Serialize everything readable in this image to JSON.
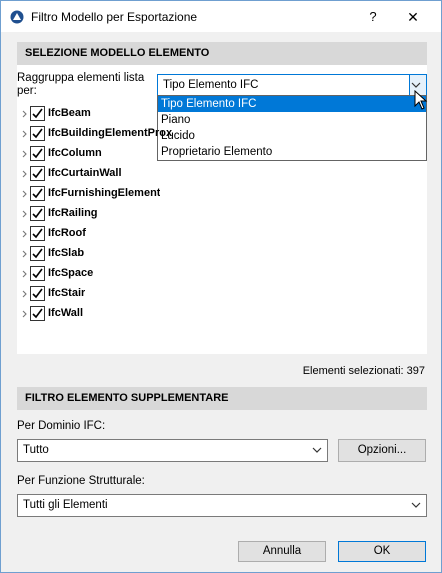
{
  "window": {
    "title": "Filtro Modello per Esportazione",
    "help_label": "?",
    "close_label": "✕"
  },
  "section1": {
    "header": "SELEZIONE MODELLO ELEMENTO"
  },
  "group_by": {
    "label": "Raggruppa elementi lista per:",
    "selected": "Tipo Elemento IFC",
    "options": [
      "Tipo Elemento IFC",
      "Piano",
      "Lucido",
      "Proprietario Elemento"
    ]
  },
  "tree": {
    "items": [
      "IfcBeam",
      "IfcBuildingElementProxy",
      "IfcColumn",
      "IfcCurtainWall",
      "IfcFurnishingElement",
      "IfcRailing",
      "IfcRoof",
      "IfcSlab",
      "IfcSpace",
      "IfcStair",
      "IfcWall"
    ]
  },
  "selected_count": "Elementi selezionati: 397",
  "section2": {
    "header": "FILTRO ELEMENTO SUPPLEMENTARE"
  },
  "domain": {
    "label": "Per Dominio IFC:",
    "value": "Tutto",
    "options_button": "Opzioni..."
  },
  "structural": {
    "label": "Per Funzione Strutturale:",
    "value": "Tutti gli Elementi"
  },
  "footer": {
    "cancel": "Annulla",
    "ok": "OK"
  }
}
